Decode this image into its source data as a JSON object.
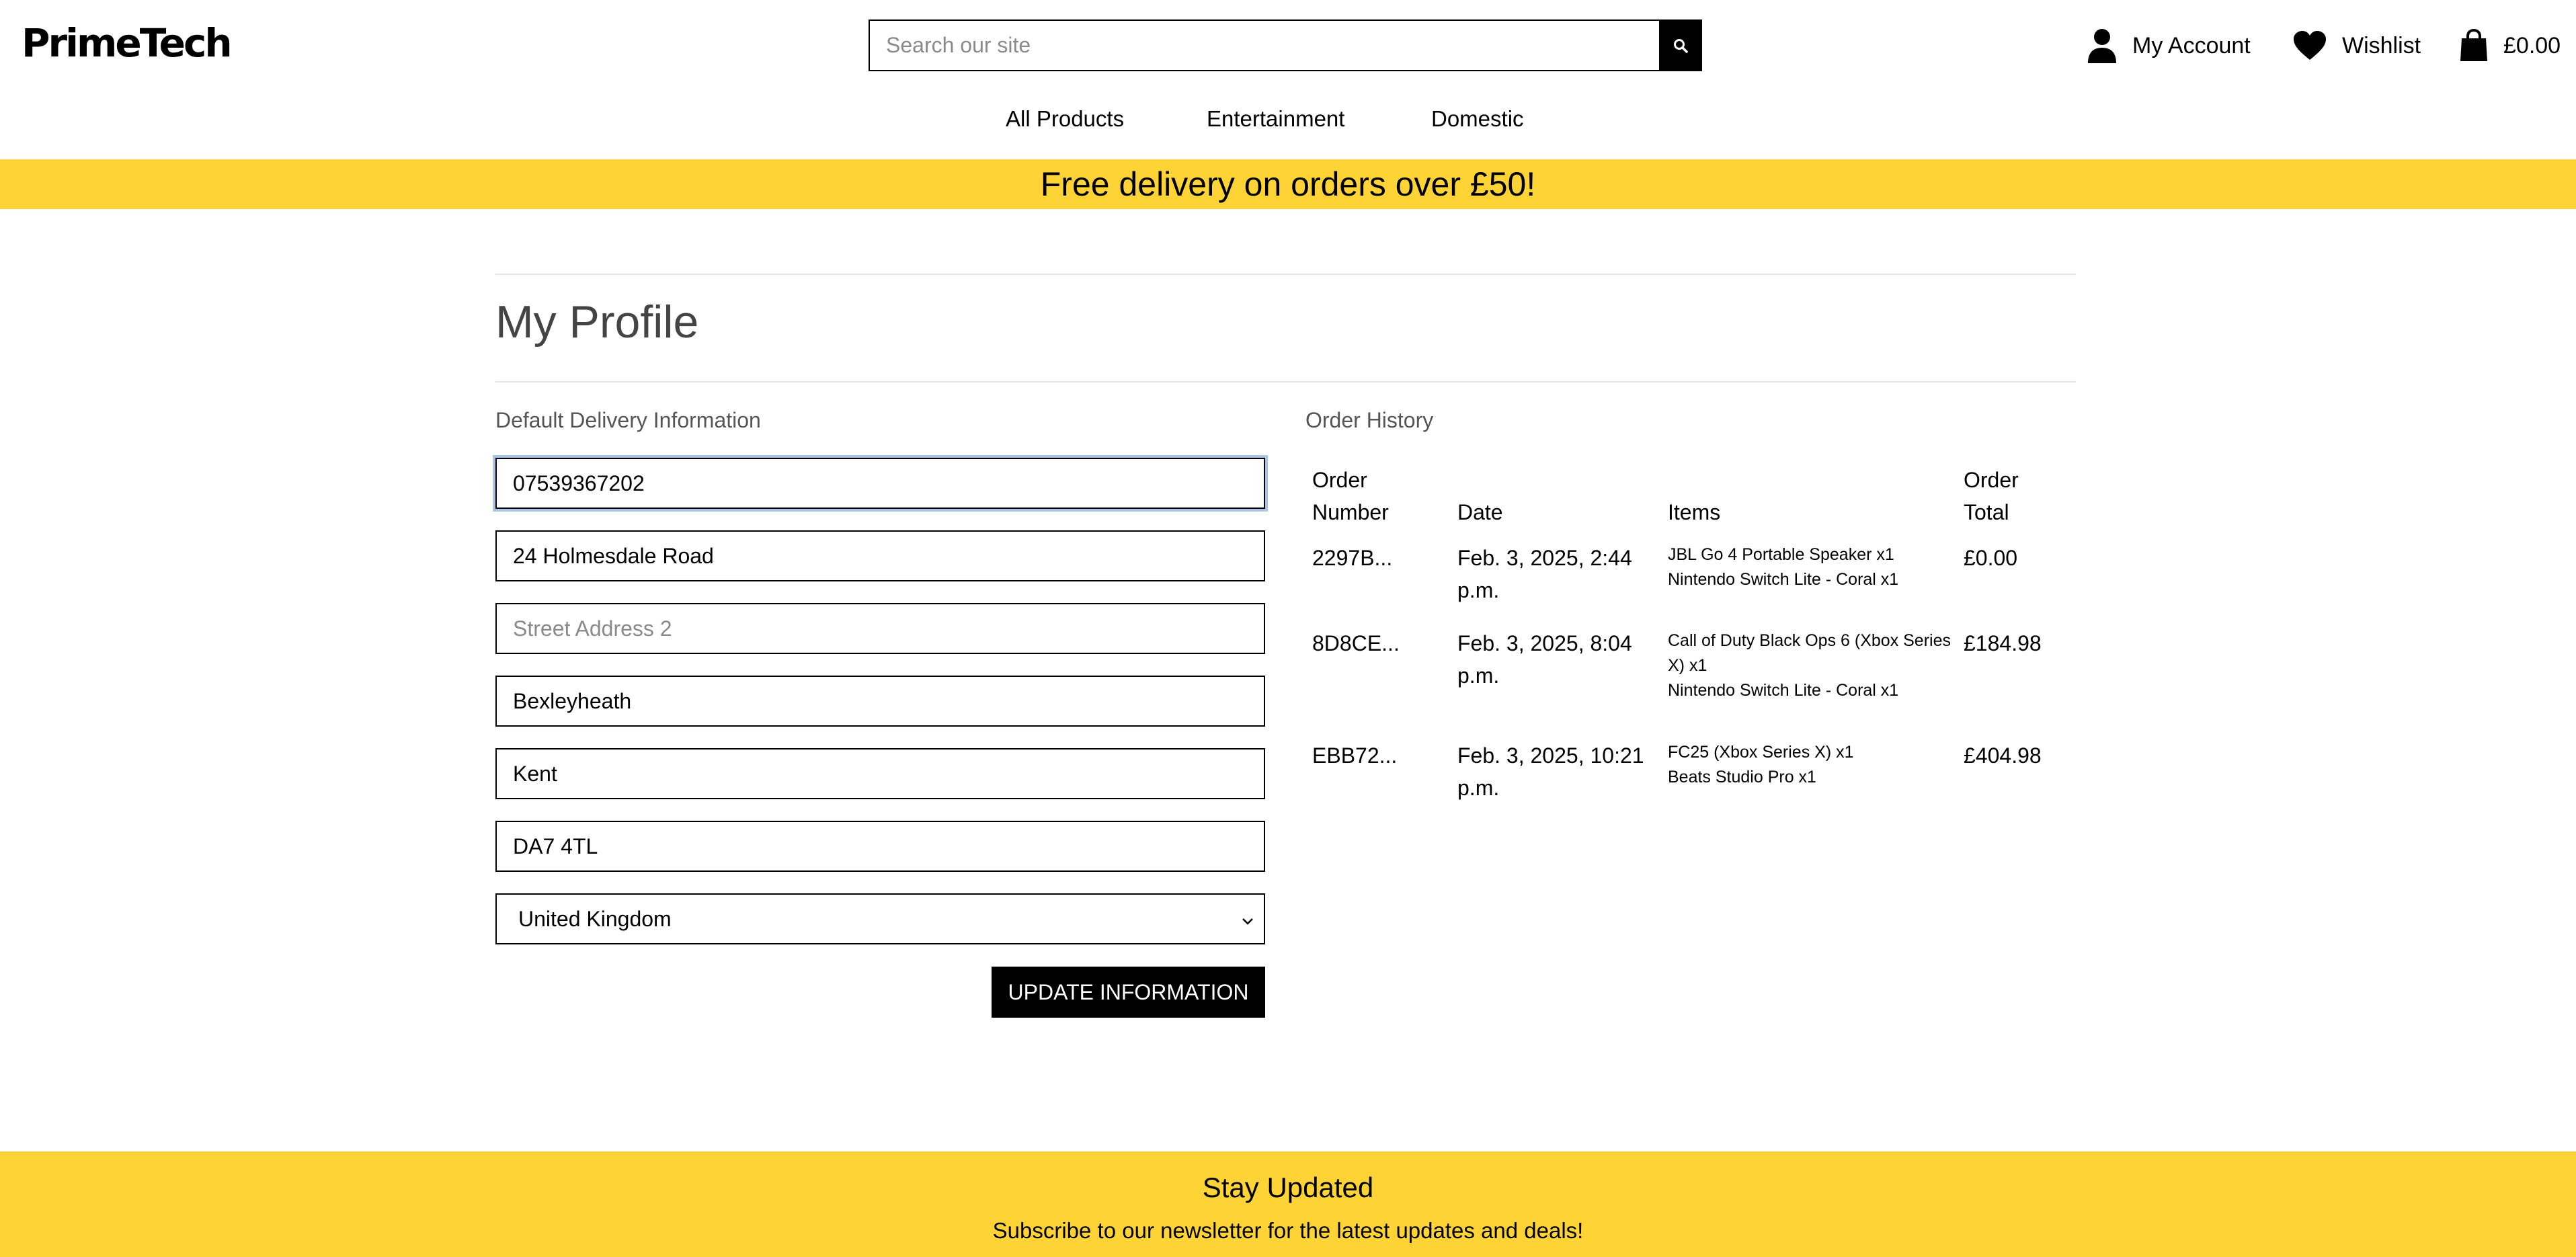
{
  "header": {
    "logo": "PrimeTech",
    "search_placeholder": "Search our site",
    "my_account": "My Account",
    "wishlist": "Wishlist",
    "bag_total": "£0.00"
  },
  "nav": {
    "items": [
      "All Products",
      "Entertainment",
      "Domestic"
    ]
  },
  "banner": "Free delivery on orders over £50!",
  "page_title": "My Profile",
  "delivery": {
    "label": "Default Delivery Information",
    "phone": "07539367202",
    "street1": "24 Holmesdale Road",
    "street2_placeholder": "Street Address 2",
    "town": "Bexleyheath",
    "county": "Kent",
    "postcode": "DA7 4TL",
    "country": "United Kingdom",
    "update_button": "UPDATE INFORMATION"
  },
  "orders": {
    "label": "Order History",
    "headers": {
      "number_1": "Order",
      "number_2": "Number",
      "date": "Date",
      "items": "Items",
      "total_1": "Order",
      "total_2": "Total"
    },
    "rows": [
      {
        "number": "2297B...",
        "date_1": "Feb. 3, 2025, 2:44",
        "date_2": "p.m.",
        "items": [
          "JBL Go 4 Portable Speaker x1",
          "Nintendo Switch Lite - Coral x1"
        ],
        "total": "£0.00"
      },
      {
        "number": "8D8CE...",
        "date_1": "Feb. 3, 2025, 8:04",
        "date_2": "p.m.",
        "items": [
          "Call of Duty Black Ops 6 (Xbox Series",
          "X) x1",
          "Nintendo Switch Lite - Coral x1"
        ],
        "total": "£184.98"
      },
      {
        "number": "EBB72...",
        "date_1": "Feb. 3, 2025, 10:21",
        "date_2": "p.m.",
        "items": [
          "FC25 (Xbox Series X) x1",
          "Beats Studio Pro x1"
        ],
        "total": "£404.98"
      }
    ]
  },
  "footer": {
    "title": "Stay Updated",
    "subtitle": "Subscribe to our newsletter for the latest updates and deals!"
  },
  "colors": {
    "brand_yellow": "#fdd335",
    "text": "#000000",
    "muted": "#555555"
  },
  "icons": [
    "search-icon",
    "user-icon",
    "heart-icon",
    "shopping-bag-icon",
    "chevron-down-icon"
  ]
}
